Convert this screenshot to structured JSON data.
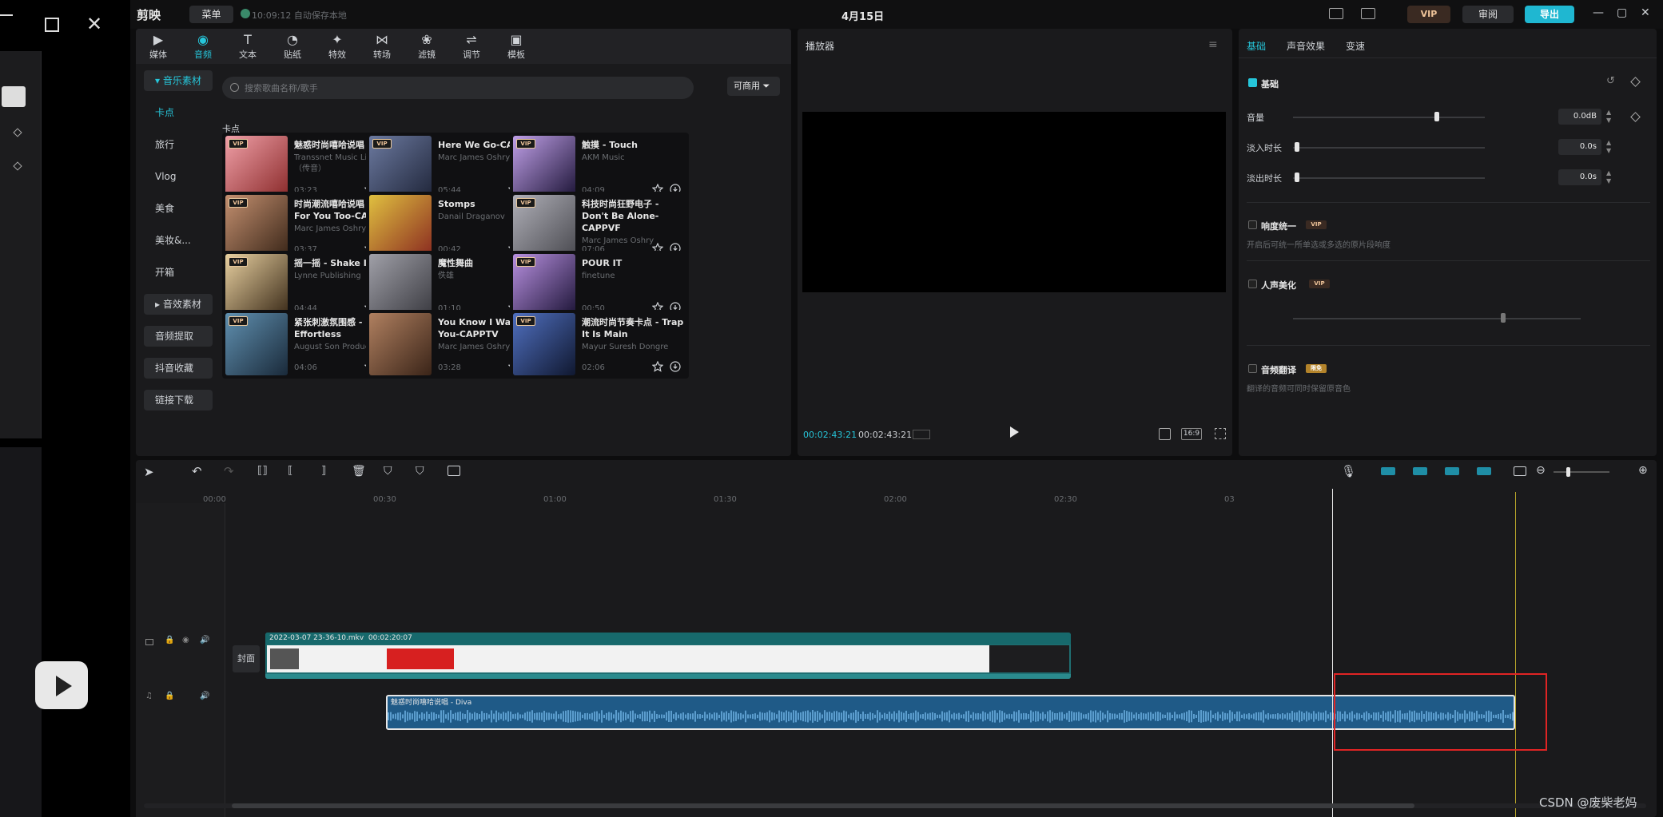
{
  "app": {
    "logo": "剪映",
    "menu_label": "菜单",
    "autosave": "10:09:12 自动保存本地",
    "project_title": "4月15日",
    "vip_label": "VIP",
    "review_label": "审阅",
    "export_label": "导出"
  },
  "media_tabs": [
    {
      "label": "媒体",
      "icon": "media-icon"
    },
    {
      "label": "音频",
      "icon": "audio-icon"
    },
    {
      "label": "文本",
      "icon": "text-icon"
    },
    {
      "label": "贴纸",
      "icon": "sticker-icon"
    },
    {
      "label": "特效",
      "icon": "effect-icon"
    },
    {
      "label": "转场",
      "icon": "transition-icon"
    },
    {
      "label": "滤镜",
      "icon": "filter-icon"
    },
    {
      "label": "调节",
      "icon": "adjust-icon"
    },
    {
      "label": "模板",
      "icon": "template-icon"
    }
  ],
  "sidebar": {
    "music_category": "音乐素材",
    "sub_items": [
      "卡点",
      "旅行",
      "Vlog",
      "美食",
      "美妆&...",
      "开箱"
    ],
    "sfx_category": "音效素材",
    "extract": "音频提取",
    "douyin": "抖音收藏",
    "link_download": "链接下载"
  },
  "search": {
    "placeholder": "搜索歌曲名称/歌手",
    "commercial": "可商用"
  },
  "section_label": "卡点",
  "tracks": [
    {
      "title": "魅惑时尚嘻哈说唱 - Diva",
      "artist": "Transsnet Music Limited（传音）",
      "duration": "03:23",
      "vip": true
    },
    {
      "title": "Here We Go-CAPPVF",
      "artist": "Marc James Oshry",
      "duration": "05:44",
      "vip": true
    },
    {
      "title": "触摸 - Touch",
      "artist": "AKM Music",
      "duration": "04:09",
      "vip": true
    },
    {
      "title": "时尚潮流嘻哈说唱 - Just For You Too-CAPPTV",
      "artist": "Marc James Oshry",
      "duration": "03:37",
      "vip": true
    },
    {
      "title": "Stomps",
      "artist": "Danail Draganov",
      "duration": "00:42",
      "vip": false
    },
    {
      "title": "科技时尚狂野电子 - Don't Be Alone-CAPPVF",
      "artist": "Marc James Oshry",
      "duration": "07:06",
      "vip": true
    },
    {
      "title": "摇一摇 - Shake It",
      "artist": "Lynne Publishing",
      "duration": "04:44",
      "vip": true
    },
    {
      "title": "魔性舞曲",
      "artist": "佚雄",
      "duration": "01:10",
      "vip": false
    },
    {
      "title": "POUR IT",
      "artist": "finetune",
      "duration": "00:50",
      "vip": true
    },
    {
      "title": "紧张刺激氛围感 - Effortless",
      "artist": "August Son Productions",
      "duration": "04:06",
      "vip": true
    },
    {
      "title": "You Know I Want You-CAPPTV",
      "artist": "Marc James Oshry",
      "duration": "03:28",
      "vip": false
    },
    {
      "title": "潮流时尚节奏卡点 - Trap It Is Main",
      "artist": "Mayur Suresh Dongre",
      "duration": "02:06",
      "vip": true
    }
  ],
  "player": {
    "title": "播放器",
    "current_time": "00:02:43:21",
    "total_time": "00:02:43:21",
    "ratio": "16:9"
  },
  "props": {
    "tabs": [
      "基础",
      "声音效果",
      "变速"
    ],
    "basic_label": "基础",
    "volume_label": "音量",
    "volume_value": "0.0dB",
    "volume_level": 0.75,
    "fadein_label": "淡入时长",
    "fadein_value": "0.0s",
    "fadeout_label": "淡出时长",
    "fadeout_value": "0.0s",
    "loudness_label": "响度统一",
    "loudness_desc": "开启后可统一所单选或多选的原片段响度",
    "voice_label": "人声美化",
    "translate_label": "音频翻译",
    "translate_badge": "限免",
    "translate_desc": "翻译的音频可同时保留原音色"
  },
  "timeline": {
    "ruler": [
      "00:00",
      "00:30",
      "01:00",
      "01:30",
      "02:00",
      "02:30",
      "03"
    ],
    "cover_label": "封面",
    "video_clip_name": "2022-03-07 23-36-10.mkv",
    "video_clip_duration": "00:02:20:07",
    "audio_clip_name": "魅惑时尚嘻哈说唱 - Diva"
  },
  "watermark": "CSDN @废柴老妈",
  "colors": {
    "accent": "#26c6da",
    "vip": "#f1c69b",
    "highlight": "#e02424"
  }
}
